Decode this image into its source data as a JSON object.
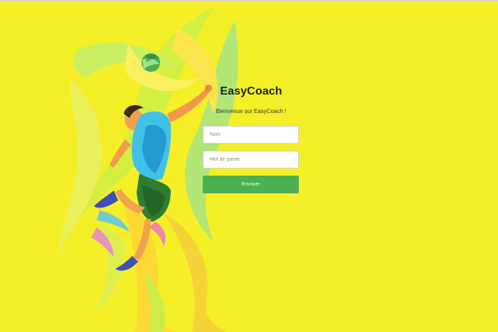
{
  "app": {
    "title": "EasyCoach",
    "welcome": "Bienvenue sur EasyCoach !"
  },
  "form": {
    "name_placeholder": "Nom",
    "password_placeholder": "Mot de passe",
    "submit_label": "Envoyer"
  },
  "colors": {
    "background": "#f5ef28",
    "submit_button": "#4caf50"
  },
  "illustration": {
    "subject": "volleyball-player-illustration"
  }
}
